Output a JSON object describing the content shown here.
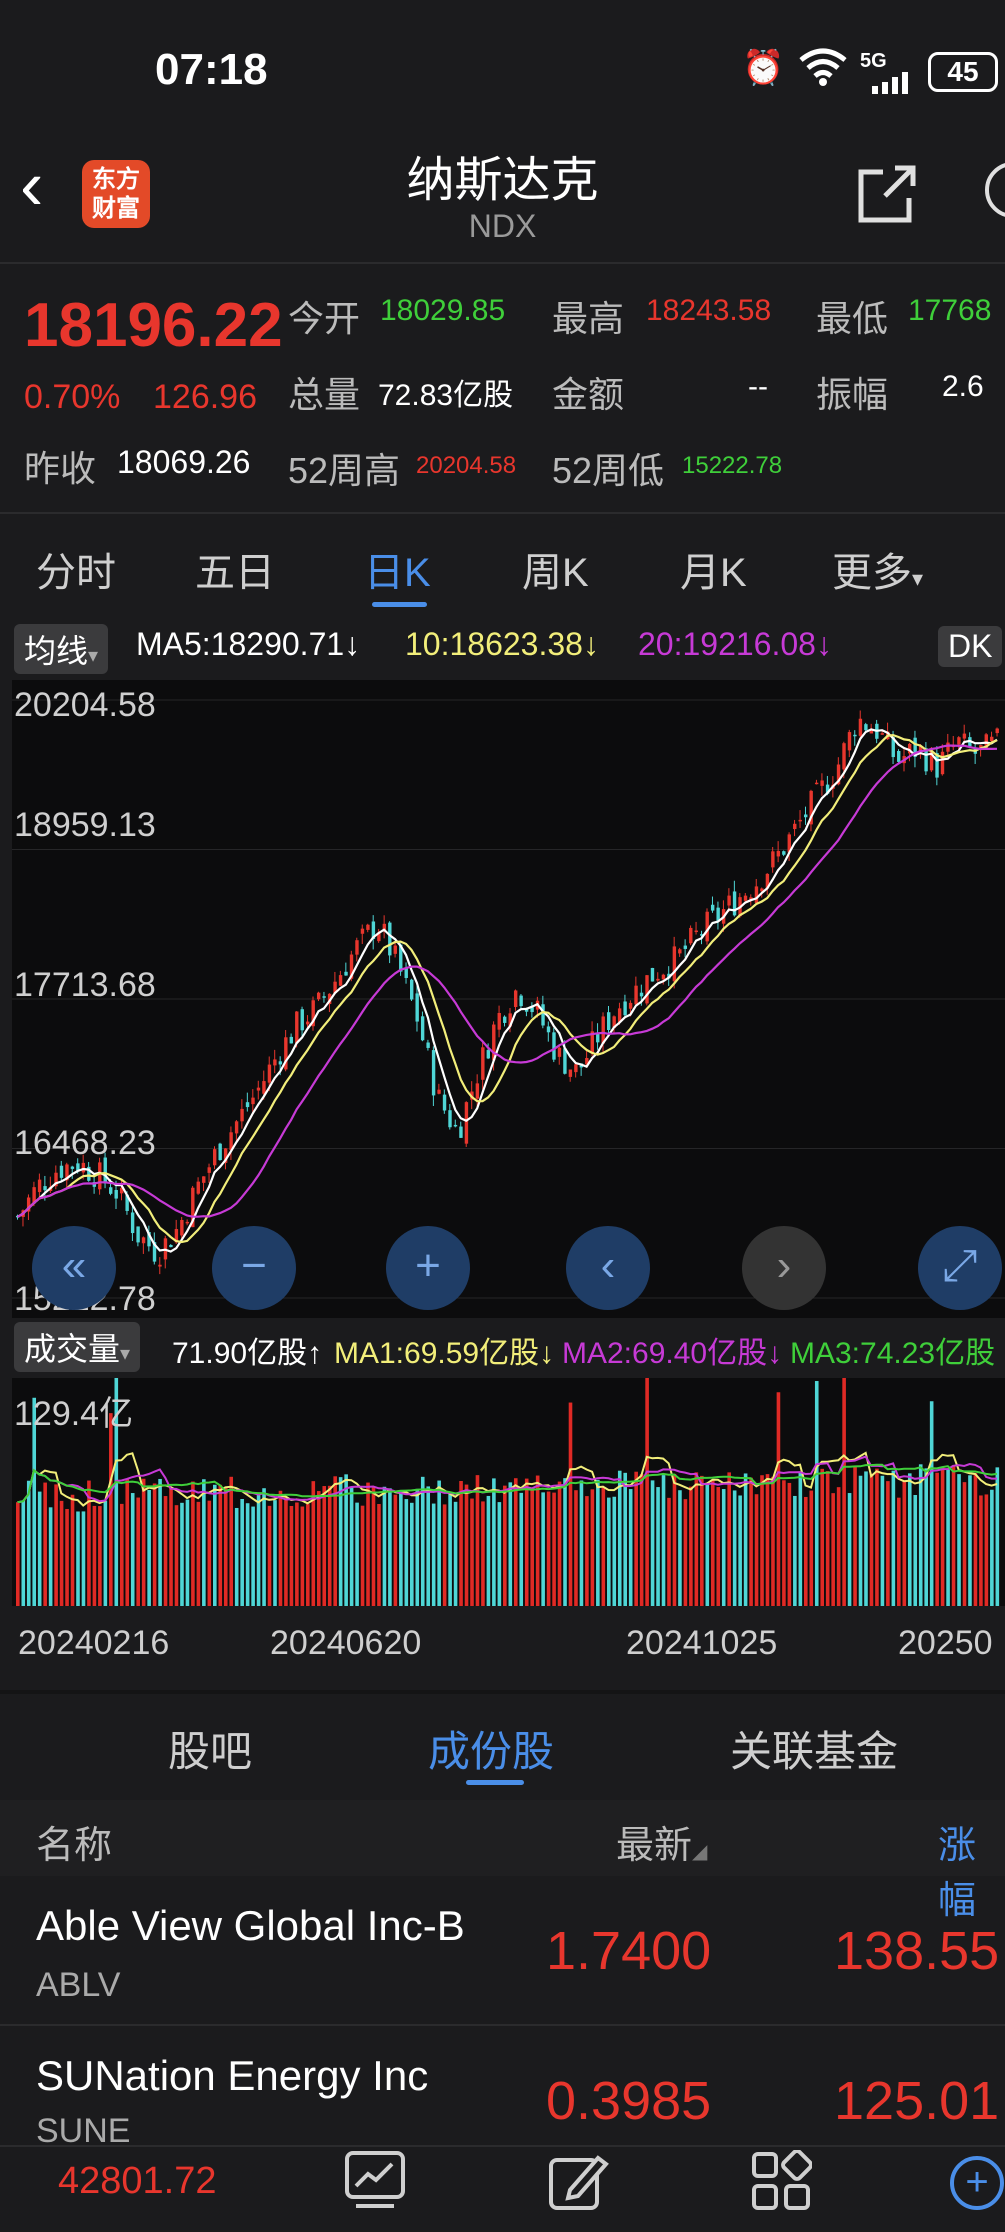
{
  "status_bar": {
    "time": "07:18",
    "network": "5G",
    "battery": "45"
  },
  "header": {
    "title": "纳斯达克",
    "code": "NDX",
    "logo_text": "东方财富"
  },
  "quote": {
    "price": "18196.22",
    "change_pct": "0.70%",
    "change": "126.96",
    "prev_close_label": "昨收",
    "prev_close": "18069.26",
    "open_label": "今开",
    "open": "18029.85",
    "high_label": "最高",
    "high": "18243.58",
    "low_label": "最低",
    "low": "17768",
    "volume_label": "总量",
    "volume": "72.83亿股",
    "amount_label": "金额",
    "amount": "--",
    "amplitude_label": "振幅",
    "amplitude": "2.6",
    "w52_high_label": "52周高",
    "w52_high": "20204.58",
    "w52_low_label": "52周低",
    "w52_low": "15222.78"
  },
  "tabs": [
    "分时",
    "五日",
    "日K",
    "周K",
    "月K",
    "更多"
  ],
  "ma_legend": {
    "selector": "均线",
    "ma5": "MA5:18290.71↓",
    "ma10": "10:18623.38↓",
    "ma20": "20:19216.08↓",
    "extra": "DK"
  },
  "price_axis": [
    "20204.58",
    "18959.13",
    "17713.68",
    "16468.23",
    "15222.78"
  ],
  "volume_legend": {
    "selector": "成交量",
    "current": "71.90亿股↑",
    "ma1": "MA1:69.59亿股↓",
    "ma2": "MA2:69.40亿股↓",
    "ma3": "MA3:74.23亿股↑"
  },
  "volume_axis_max": "129.4亿",
  "dates": [
    "20240216",
    "20240620",
    "20241025",
    "20250"
  ],
  "section_tabs": [
    "股吧",
    "成份股",
    "关联基金"
  ],
  "list_header": {
    "name": "名称",
    "latest": "最新",
    "change": "涨幅"
  },
  "rows": [
    {
      "name": "Able View Global Inc-B",
      "code": "ABLV",
      "price": "1.7400",
      "change": "138.55"
    },
    {
      "name": "SUNation Energy Inc",
      "code": "SUNE",
      "price": "0.3985",
      "change": "125.01"
    }
  ],
  "bottom_nav": {
    "price": "42801.72"
  },
  "colors": {
    "up": "#e8362d",
    "down": "#3fcf3a",
    "accent": "#4a8ee8",
    "ma5": "#ffffff",
    "ma10": "#f2ee7a",
    "ma20": "#c73ad6"
  },
  "chart_data": {
    "type": "candlestick",
    "ylim": [
      15222.78,
      20204.58
    ],
    "close_trend": [
      15900,
      16150,
      16300,
      16350,
      16250,
      16100,
      15750,
      15600,
      15800,
      16150,
      16450,
      16700,
      16950,
      17250,
      17500,
      17650,
      17900,
      18150,
      18350,
      18000,
      17550,
      16900,
      16600,
      17100,
      17550,
      17800,
      17600,
      17250,
      17100,
      17400,
      17650,
      17800,
      17950,
      18050,
      18250,
      18400,
      18550,
      18700,
      18900,
      19150,
      19400,
      19650,
      20050,
      19950,
      19700,
      19800,
      19650,
      19850,
      19750,
      19850
    ]
  },
  "volume_data": {
    "type": "bar",
    "ylim": [
      0,
      129.4
    ]
  }
}
